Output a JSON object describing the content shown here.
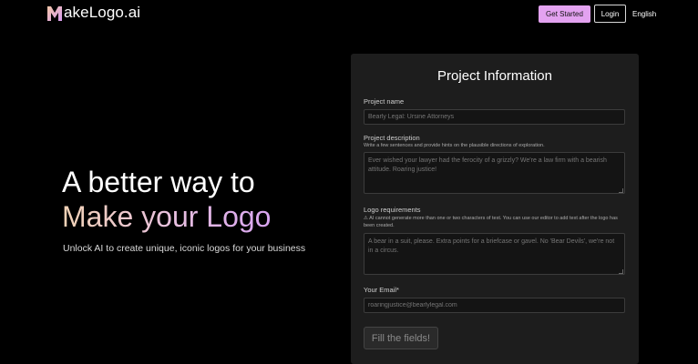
{
  "header": {
    "brand": "akeLogo.ai",
    "get_started_label": "Get Started",
    "login_label": "Login",
    "language": "English"
  },
  "hero": {
    "line1": "A better way to",
    "line2": "Make your Logo",
    "subtitle": "Unlock AI to create unique, iconic logos for your business"
  },
  "form": {
    "title": "Project Information",
    "project_name": {
      "label": "Project name",
      "placeholder": "Bearly Legal: Ursine Attorneys"
    },
    "project_description": {
      "label": "Project description",
      "hint": "Write a few sentences and provide hints on the plausible directions of exploration.",
      "placeholder": "Ever wished your lawyer had the ferocity of a grizzly? We're a law firm with a bearish attitude. Roaring justice!"
    },
    "logo_requirements": {
      "label": "Logo requirements",
      "hint": "⚠ AI cannot generate more than one or two characters of text. You can use our editor to add text after the logo has been created.",
      "placeholder": "A bear in a suit, please. Extra points for a briefcase or gavel. No 'Bear Devils', we're not in a circus."
    },
    "email": {
      "label": "Your Email*",
      "placeholder": "roaringjustice@bearlylegal.com"
    },
    "submit_label": "Fill the fields!"
  },
  "colors": {
    "accent": "#e3a2f0",
    "background": "#000000",
    "card": "#1d1d1d"
  }
}
